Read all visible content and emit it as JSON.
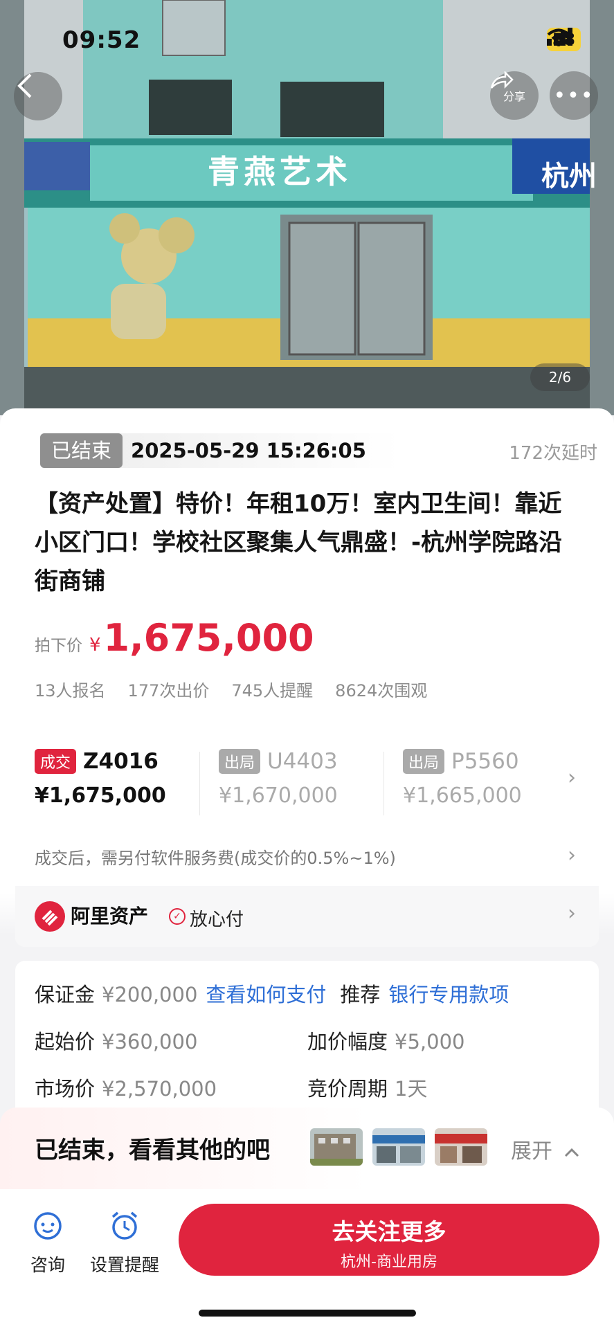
{
  "status_bar": {
    "time": "09:52",
    "battery": "58"
  },
  "hero": {
    "store_sign": "青燕艺术",
    "side_sign": "杭州",
    "share_label": "分享",
    "image_counter": "2/6"
  },
  "auction": {
    "status": "已结束",
    "end_time": "2025-05-29 15:26:05",
    "delay_count": "172次延时",
    "title": "【资产处置】特价！年租10万！室内卫生间！靠近小区门口！学校社区聚集人气鼎盛！-杭州学院路沿街商铺",
    "price_label": "拍下价",
    "price_currency": "¥",
    "price_value": "1,675,000",
    "stats": [
      "13人报名",
      "177次出价",
      "745人提醒",
      "8624次围观"
    ]
  },
  "bids": [
    {
      "tag": "成交",
      "code": "Z4016",
      "amount": "¥1,675,000"
    },
    {
      "tag": "出局",
      "code": "U4403",
      "amount": "¥1,670,000"
    },
    {
      "tag": "出局",
      "code": "P5560",
      "amount": "¥1,665,000"
    }
  ],
  "service_fee": "成交后，需另付软件服务费(成交价的0.5%~1%)",
  "ali": {
    "name": "阿里资产",
    "safe_pay": "放心付"
  },
  "details": {
    "deposit_label": "保证金",
    "deposit_value": "¥200,000",
    "deposit_link": "查看如何支付",
    "recommend_label": "推荐",
    "recommend_link": "银行专用款项",
    "start_label": "起始价",
    "start_value": "¥360,000",
    "increment_label": "加价幅度",
    "increment_value": "¥5,000",
    "market_label": "市场价",
    "market_value": "¥2,570,000",
    "cycle_label": "竞价周期",
    "cycle_value": "1天"
  },
  "ended_banner": {
    "text": "已结束，看看其他的吧",
    "expand": "展开"
  },
  "bottom_bar": {
    "consult": "咨询",
    "reminder": "设置提醒",
    "cta_main": "去关注更多",
    "cta_sub": "杭州-商业用房"
  },
  "colors": {
    "accent": "#e0243e",
    "link": "#2f6fd6",
    "muted": "#8d8d8d"
  }
}
